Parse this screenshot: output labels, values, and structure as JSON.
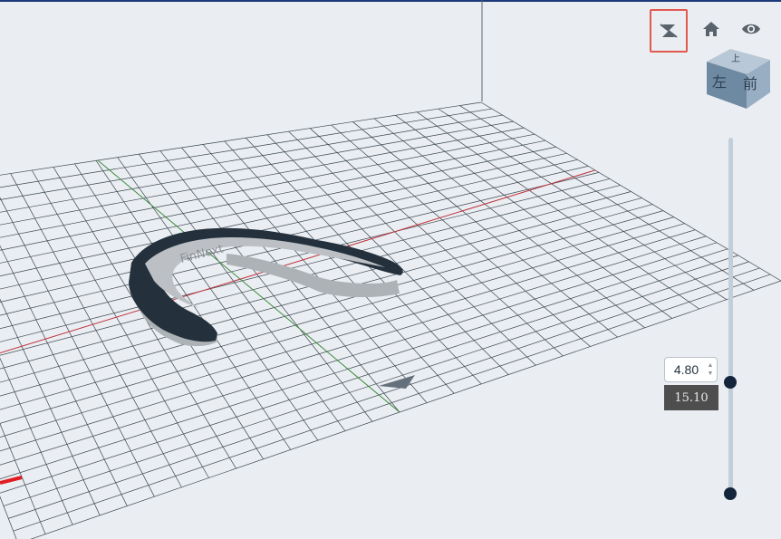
{
  "toolbar": {
    "icons": [
      "layer-view-icon",
      "home-icon",
      "visibility-eye-icon"
    ]
  },
  "view_cube": {
    "front_label": "前",
    "left_label": "左",
    "top_label": "上"
  },
  "embossed_text": "FinNext",
  "layer_slider": {
    "value": "4.80",
    "layer_height_label": "15.10",
    "spin_up": "▲",
    "spin_down": "▼"
  },
  "colors": {
    "background": "#eaeef2",
    "grid": "#3b4550",
    "x_axis": "#c0303a",
    "y_axis": "#3b8a3b",
    "model_gray": "#a9aeb2",
    "model_dark": "#24313d",
    "active_outline": "#e25a4f",
    "handle": "#13243b"
  }
}
